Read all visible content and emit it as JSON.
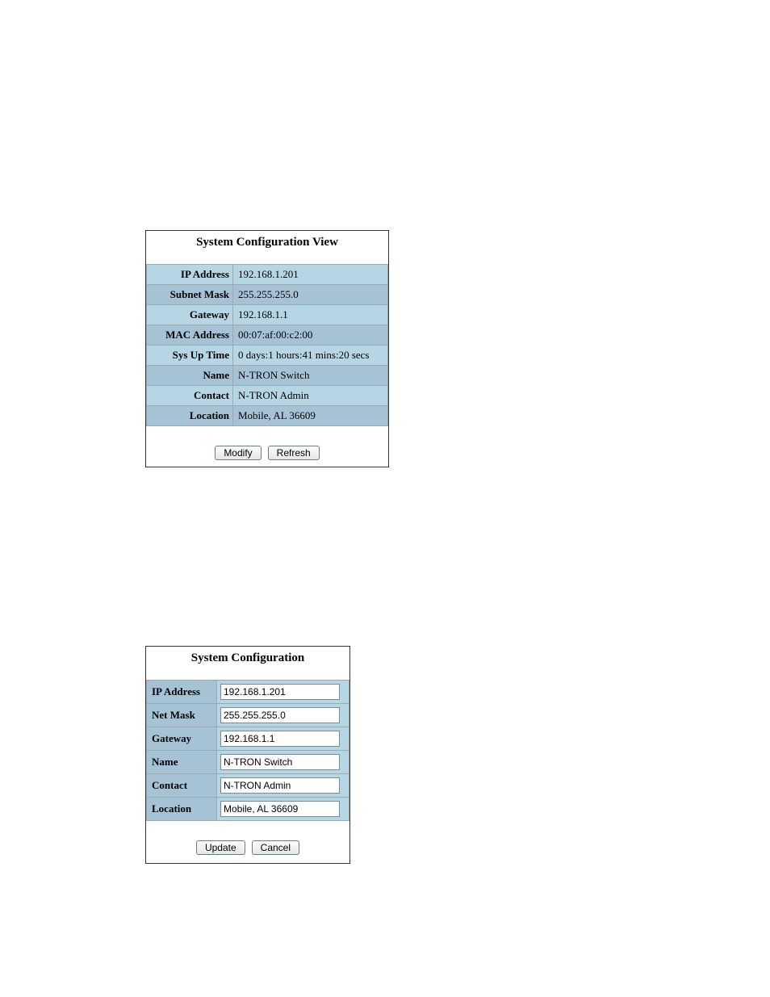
{
  "view": {
    "title": "System Configuration View",
    "rows": {
      "ip_address": {
        "label": "IP Address",
        "value": "192.168.1.201"
      },
      "subnet_mask": {
        "label": "Subnet Mask",
        "value": "255.255.255.0"
      },
      "gateway": {
        "label": "Gateway",
        "value": "192.168.1.1"
      },
      "mac_address": {
        "label": "MAC Address",
        "value": "00:07:af:00:c2:00"
      },
      "sys_up_time": {
        "label": "Sys Up Time",
        "value": "0 days:1 hours:41 mins:20 secs"
      },
      "name": {
        "label": "Name",
        "value": "N-TRON Switch"
      },
      "contact": {
        "label": "Contact",
        "value": "N-TRON Admin"
      },
      "location": {
        "label": "Location",
        "value": "Mobile, AL 36609"
      }
    },
    "buttons": {
      "modify": "Modify",
      "refresh": "Refresh"
    }
  },
  "edit": {
    "title": "System Configuration",
    "rows": {
      "ip_address": {
        "label": "IP Address",
        "value": "192.168.1.201"
      },
      "net_mask": {
        "label": "Net Mask",
        "value": "255.255.255.0"
      },
      "gateway": {
        "label": "Gateway",
        "value": "192.168.1.1"
      },
      "name": {
        "label": "Name",
        "value": "N-TRON Switch"
      },
      "contact": {
        "label": "Contact",
        "value": "N-TRON Admin"
      },
      "location": {
        "label": "Location",
        "value": "Mobile, AL 36609"
      }
    },
    "buttons": {
      "update": "Update",
      "cancel": "Cancel"
    }
  }
}
